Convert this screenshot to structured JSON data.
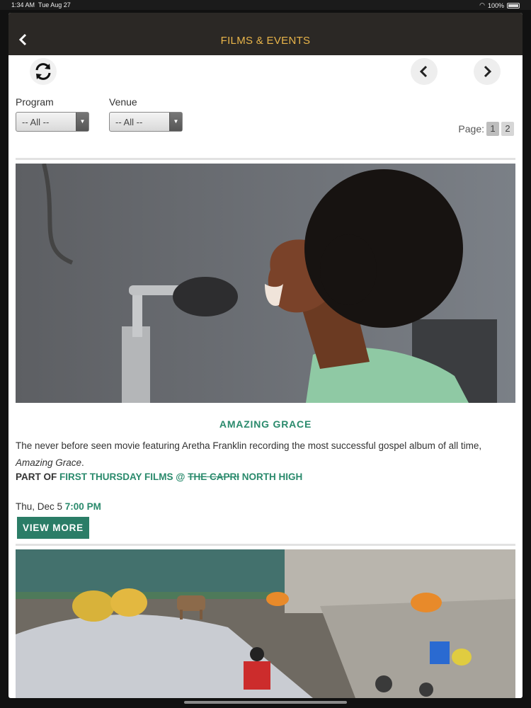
{
  "status": {
    "time": "1:34 AM",
    "date": "Tue Aug 27",
    "battery": "100%"
  },
  "nav": {
    "title": "FILMS & EVENTS",
    "back_icon": "chevron-left-icon"
  },
  "toolbar": {
    "refresh_icon": "refresh-icon",
    "prev_icon": "chevron-left-icon",
    "next_icon": "chevron-right-icon"
  },
  "filters": {
    "program_label": "Program",
    "program_value": "-- All --",
    "venue_label": "Venue",
    "venue_value": "-- All --"
  },
  "pagination": {
    "label": "Page:",
    "pages": [
      "1",
      "2"
    ],
    "current": "1"
  },
  "films": [
    {
      "title": "AMAZING GRACE",
      "desc_text": "The never before seen movie featuring Aretha Franklin recording the most successful gospel album of all time, ",
      "desc_italic": "Amazing Grace",
      "desc_end": ".",
      "part_of_label": "PART OF",
      "series": "FIRST THURSDAY FILMS @",
      "venue_struck": "THE CAPRI",
      "venue": "NORTH HIGH",
      "day": "Thu, Dec 5",
      "time": "7:00 PM",
      "button": "VIEW MORE"
    }
  ],
  "colors": {
    "accent": "#2a8a6c",
    "nav_title": "#e9b54a",
    "nav_bg": "#2b2825"
  }
}
